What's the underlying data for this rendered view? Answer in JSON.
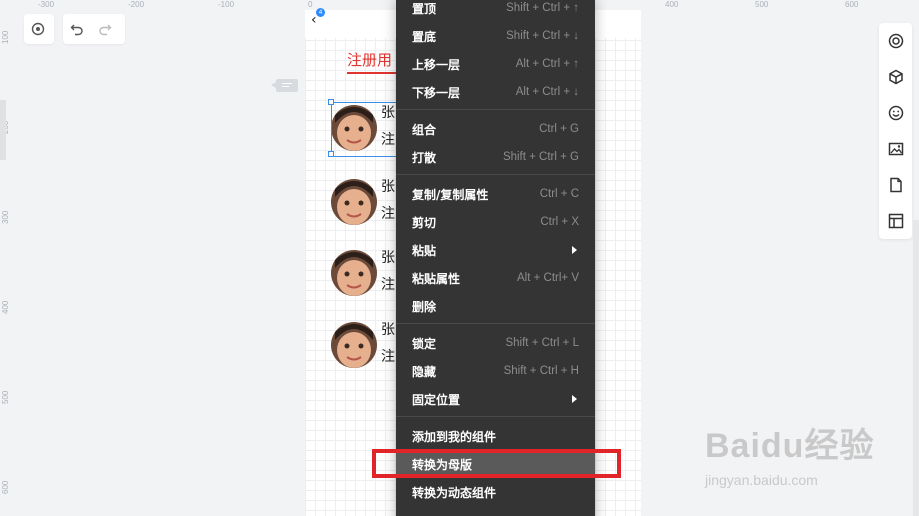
{
  "ruler": {
    "top_ticks": [
      "-300",
      "-200",
      "-100",
      "0",
      "100",
      "200",
      "300",
      "400",
      "500",
      "600"
    ],
    "left_ticks": [
      "100",
      "200",
      "300",
      "400",
      "500",
      "600"
    ]
  },
  "toolbar": {
    "target_icon": "target-icon",
    "undo_icon": "undo-icon",
    "redo_icon": "redo-icon"
  },
  "artboard": {
    "badge": "4",
    "tab_title": "注册用",
    "items": [
      {
        "name": "张",
        "sub": "注"
      },
      {
        "name": "张",
        "sub": "注"
      },
      {
        "name": "张",
        "sub": "注"
      },
      {
        "name": "张",
        "sub": "注"
      }
    ]
  },
  "context_menu": {
    "items": [
      {
        "label": "置顶",
        "shortcut": "Shift + Ctrl + ↑"
      },
      {
        "label": "置底",
        "shortcut": "Shift + Ctrl + ↓"
      },
      {
        "label": "上移一层",
        "shortcut": "Alt + Ctrl + ↑"
      },
      {
        "label": "下移一层",
        "shortcut": "Alt + Ctrl + ↓"
      },
      {
        "label": "组合",
        "shortcut": "Ctrl + G"
      },
      {
        "label": "打散",
        "shortcut": "Shift + Ctrl + G"
      },
      {
        "label": "复制/复制属性",
        "shortcut": "Ctrl + C"
      },
      {
        "label": "剪切",
        "shortcut": "Ctrl + X"
      },
      {
        "label": "粘贴",
        "shortcut": ""
      },
      {
        "label": "粘贴属性",
        "shortcut": "Alt + Ctrl+ V"
      },
      {
        "label": "删除",
        "shortcut": ""
      },
      {
        "label": "锁定",
        "shortcut": "Shift + Ctrl + L"
      },
      {
        "label": "隐藏",
        "shortcut": "Shift + Ctrl + H"
      },
      {
        "label": "固定位置",
        "shortcut": ""
      },
      {
        "label": "添加到我的组件",
        "shortcut": ""
      },
      {
        "label": "转换为母版",
        "shortcut": ""
      },
      {
        "label": "转换为动态组件",
        "shortcut": ""
      }
    ]
  },
  "right_sidebar": {
    "icons": [
      "target-icon",
      "cube-icon",
      "smiley-icon",
      "image-icon",
      "file-icon",
      "layout-icon"
    ]
  },
  "watermark": {
    "brand": "Baidu经验",
    "sub": "jingyan.baidu.com"
  },
  "colors": {
    "accent_red": "#e0342f",
    "menu_bg": "#343434",
    "highlight_box": "#e0242a",
    "selection_blue": "#3a8ee6"
  }
}
